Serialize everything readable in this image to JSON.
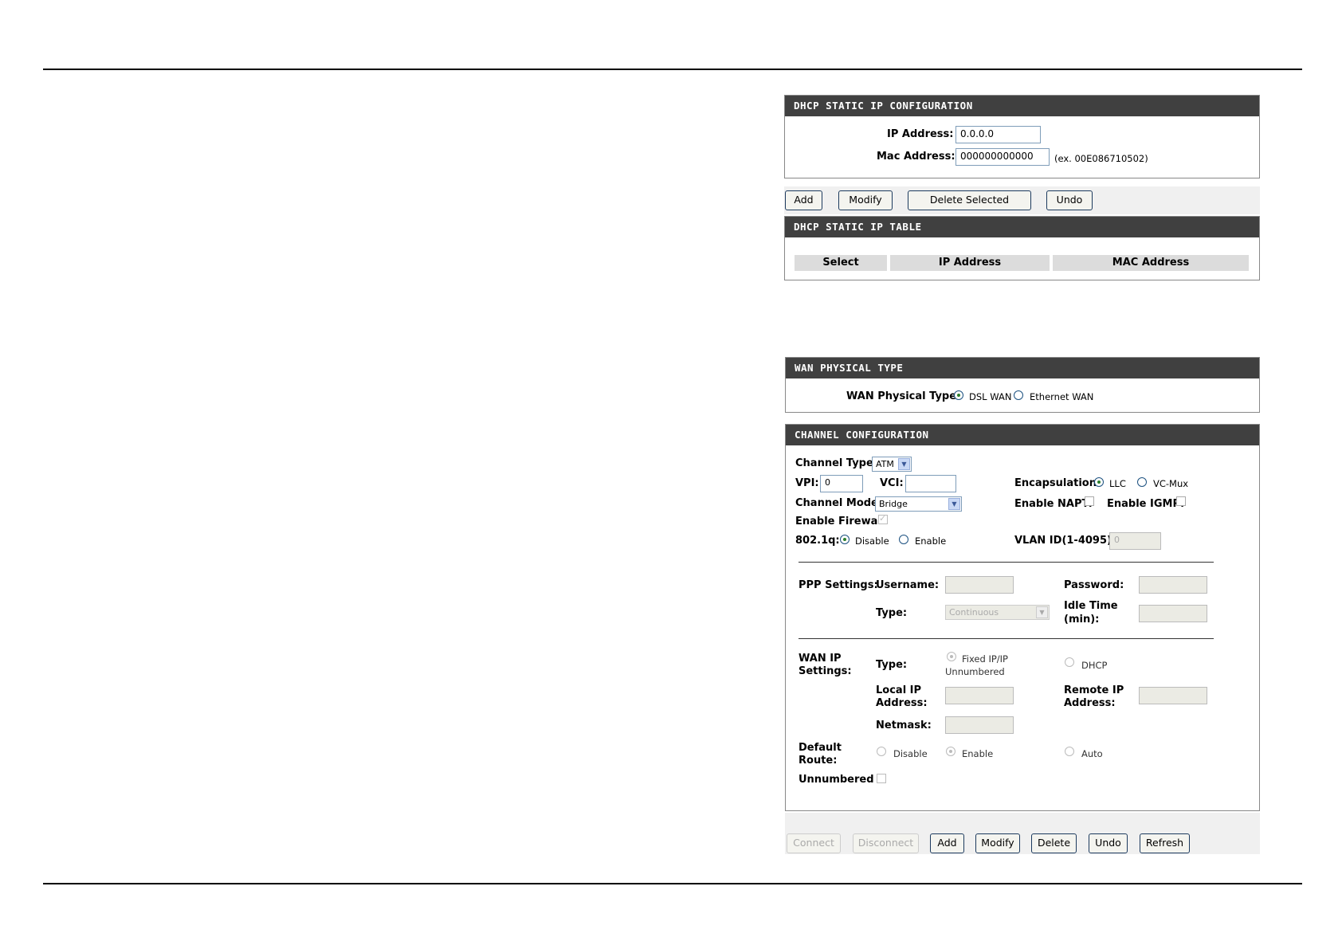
{
  "dhcp_config": {
    "header": "DHCP STATIC IP CONFIGURATION",
    "ip_label": "IP Address:",
    "ip_value": "0.0.0.0",
    "mac_label": "Mac Address:",
    "mac_value": "000000000000",
    "mac_example": "(ex. 00E086710502)"
  },
  "dhcp_buttons": {
    "add": "Add",
    "modify": "Modify",
    "delete_selected": "Delete Selected",
    "undo": "Undo"
  },
  "dhcp_table": {
    "header": "DHCP STATIC IP TABLE",
    "columns": [
      "Select",
      "IP Address",
      "MAC Address"
    ]
  },
  "wan_type": {
    "header": "WAN PHYSICAL TYPE",
    "label": "WAN Physical Type:",
    "options": [
      "DSL WAN",
      "Ethernet WAN"
    ],
    "selected": "DSL WAN"
  },
  "channel": {
    "header": "CHANNEL CONFIGURATION",
    "channel_type_label": "Channel Type:",
    "channel_type_value": "ATM",
    "vpi_label": "VPI:",
    "vpi_value": "0",
    "vci_label": "VCI:",
    "vci_value": "",
    "encap_label": "Encapsulation:",
    "encap_options": [
      "LLC",
      "VC-Mux"
    ],
    "encap_selected": "LLC",
    "mode_label": "Channel Mode:",
    "mode_value": "Bridge",
    "napt_label": "Enable NAPT:",
    "igmp_label": "Enable IGMP:",
    "firewall_label": "Enable Firewall:",
    "dot1q_label": "802.1q:",
    "dot1q_options": [
      "Disable",
      "Enable"
    ],
    "dot1q_selected": "Disable",
    "vlan_label": "VLAN ID(1-4095):",
    "vlan_value": "0"
  },
  "ppp": {
    "section_label": "PPP Settings:",
    "username_label": "Username:",
    "password_label": "Password:",
    "type_label": "Type:",
    "type_value": "Continuous",
    "idle_label_1": "Idle Time",
    "idle_label_2": "(min):"
  },
  "wanip": {
    "section_label_1": "WAN IP",
    "section_label_2": "Settings:",
    "type_label": "Type:",
    "fixed_option_1": "Fixed IP/IP",
    "fixed_option_2": "Unnumbered",
    "dhcp_option": "DHCP",
    "local_label_1": "Local IP",
    "local_label_2": "Address:",
    "remote_label_1": "Remote IP",
    "remote_label_2": "Address:",
    "netmask_label": "Netmask:",
    "default_route_1": "Default",
    "default_route_2": "Route:",
    "route_options": [
      "Disable",
      "Enable",
      "Auto"
    ],
    "route_selected": "Enable",
    "unnumbered_label": "Unnumbered"
  },
  "bottom_buttons": {
    "connect": "Connect",
    "disconnect": "Disconnect",
    "add": "Add",
    "modify": "Modify",
    "delete": "Delete",
    "undo": "Undo",
    "refresh": "Refresh"
  }
}
